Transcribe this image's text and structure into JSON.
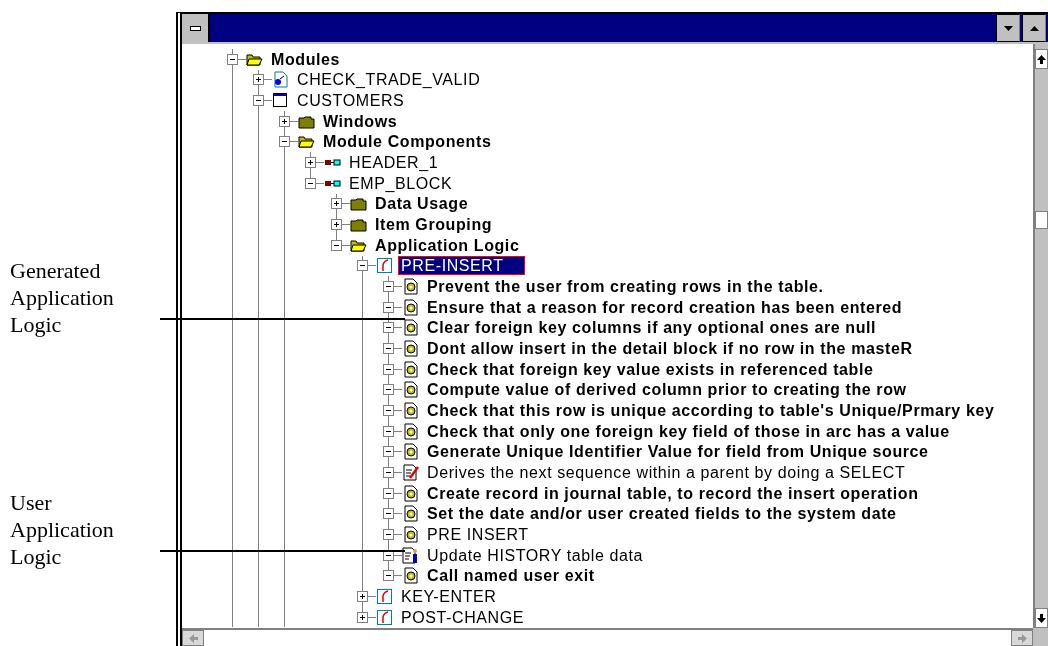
{
  "annotations": [
    {
      "text": "Generated Application Logic"
    },
    {
      "text": "User Application Logic"
    }
  ],
  "tree": {
    "items": [
      {
        "label": "Modules",
        "kind": "folder",
        "bold": true,
        "expanded": true,
        "selected": false,
        "more_below": true,
        "children": [
          {
            "label": "CHECK_TRADE_VALID",
            "kind": "library",
            "bold": false,
            "expanded": false,
            "selected": false
          },
          {
            "label": "CUSTOMERS",
            "kind": "form",
            "bold": false,
            "expanded": true,
            "selected": false,
            "more_below": true,
            "children": [
              {
                "label": "Windows",
                "kind": "folder",
                "bold": true,
                "expanded": false,
                "selected": false
              },
              {
                "label": "Module Components",
                "kind": "folder",
                "bold": true,
                "expanded": true,
                "selected": false,
                "more_below": true,
                "children": [
                  {
                    "label": "HEADER_1",
                    "kind": "block",
                    "bold": false,
                    "expanded": false,
                    "selected": false
                  },
                  {
                    "label": "EMP_BLOCK",
                    "kind": "block",
                    "bold": false,
                    "expanded": true,
                    "selected": false,
                    "children": [
                      {
                        "label": "Data Usage",
                        "kind": "folder",
                        "bold": true,
                        "expanded": false,
                        "selected": false
                      },
                      {
                        "label": "Item Grouping",
                        "kind": "folder",
                        "bold": true,
                        "expanded": false,
                        "selected": false
                      },
                      {
                        "label": "Application Logic",
                        "kind": "folder",
                        "bold": true,
                        "expanded": true,
                        "selected": false,
                        "children": [
                          {
                            "label": "PRE-INSERT",
                            "kind": "trigger",
                            "bold": false,
                            "expanded": true,
                            "selected": true,
                            "children": [
                              {
                                "label": "Prevent the user from creating rows in the table.",
                                "kind": "code",
                                "bold": true,
                                "expanded": true,
                                "selected": false
                              },
                              {
                                "label": "Ensure that a reason for record creation has been entered",
                                "kind": "code",
                                "bold": true,
                                "expanded": true,
                                "selected": false
                              },
                              {
                                "label": "Clear foreign key columns if any optional ones are null",
                                "kind": "code",
                                "bold": true,
                                "expanded": true,
                                "selected": false
                              },
                              {
                                "label": "Dont allow insert in the detail block if no row in the masteR",
                                "kind": "code",
                                "bold": true,
                                "expanded": true,
                                "selected": false
                              },
                              {
                                "label": "Check that foreign key value exists in referenced table",
                                "kind": "code",
                                "bold": true,
                                "expanded": true,
                                "selected": false
                              },
                              {
                                "label": "Compute value of derived column prior to creating the row",
                                "kind": "code",
                                "bold": true,
                                "expanded": true,
                                "selected": false
                              },
                              {
                                "label": "Check that this row is unique according to table's Unique/Prmary key",
                                "kind": "code",
                                "bold": true,
                                "expanded": true,
                                "selected": false
                              },
                              {
                                "label": "Check that only one foreign key field of those in arc has a value",
                                "kind": "code",
                                "bold": true,
                                "expanded": true,
                                "selected": false
                              },
                              {
                                "label": "Generate Unique Identifier Value for field from Unique source",
                                "kind": "code",
                                "bold": true,
                                "expanded": true,
                                "selected": false
                              },
                              {
                                "label": "Derives the next sequence within a parent by doing a SELECT",
                                "kind": "sql",
                                "bold": false,
                                "expanded": true,
                                "selected": false
                              },
                              {
                                "label": "Create record in journal table, to record the insert operation",
                                "kind": "code",
                                "bold": true,
                                "expanded": true,
                                "selected": false
                              },
                              {
                                "label": "Set the date and/or user created fields to the system date",
                                "kind": "code",
                                "bold": true,
                                "expanded": true,
                                "selected": false
                              },
                              {
                                "label": "PRE INSERT",
                                "kind": "code",
                                "bold": false,
                                "expanded": true,
                                "selected": false
                              },
                              {
                                "label": "Update HISTORY table data",
                                "kind": "user",
                                "bold": false,
                                "expanded": true,
                                "selected": false
                              },
                              {
                                "label": "Call named user exit",
                                "kind": "code",
                                "bold": true,
                                "expanded": true,
                                "selected": false
                              }
                            ]
                          },
                          {
                            "label": "KEY-ENTER",
                            "kind": "trigger",
                            "bold": false,
                            "expanded": false,
                            "selected": false
                          },
                          {
                            "label": "POST-CHANGE",
                            "kind": "trigger",
                            "bold": false,
                            "expanded": false,
                            "selected": false
                          }
                        ]
                      }
                    ]
                  }
                ]
              }
            ]
          }
        ]
      }
    ]
  }
}
